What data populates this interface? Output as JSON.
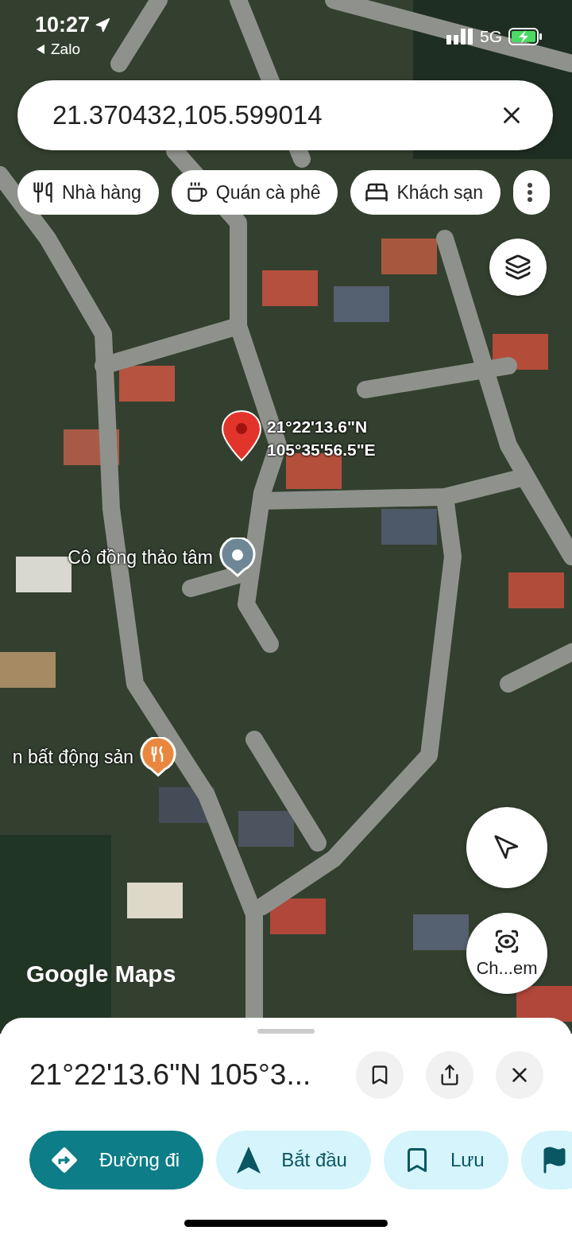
{
  "status_bar": {
    "time": "10:27",
    "back_label": "Zalo",
    "network": "5G"
  },
  "search": {
    "value": "21.370432,105.599014"
  },
  "chips": [
    {
      "kind": "restaurant",
      "label": "Nhà hàng"
    },
    {
      "kind": "cafe",
      "label": "Quán cà phê"
    },
    {
      "kind": "hotel",
      "label": "Khách sạn"
    },
    {
      "kind": "more"
    }
  ],
  "pin": {
    "lat": "21°22'13.6\"N",
    "lng": "105°35'56.5\"E"
  },
  "places": [
    {
      "kind": "place",
      "name": "Cô đồng thảo tâm"
    },
    {
      "kind": "restaurant",
      "name": "n bất động sản"
    }
  ],
  "camera_button": {
    "label": "Ch...em"
  },
  "logo": {
    "text": "Google Maps"
  },
  "sheet": {
    "title": "21°22'13.6\"N 105°3...",
    "actions": [
      {
        "kind": "directions",
        "label": "Đường đi"
      },
      {
        "kind": "start",
        "label": "Bắt đầu"
      },
      {
        "kind": "save",
        "label": "Lưu"
      },
      {
        "kind": "flag"
      }
    ]
  }
}
